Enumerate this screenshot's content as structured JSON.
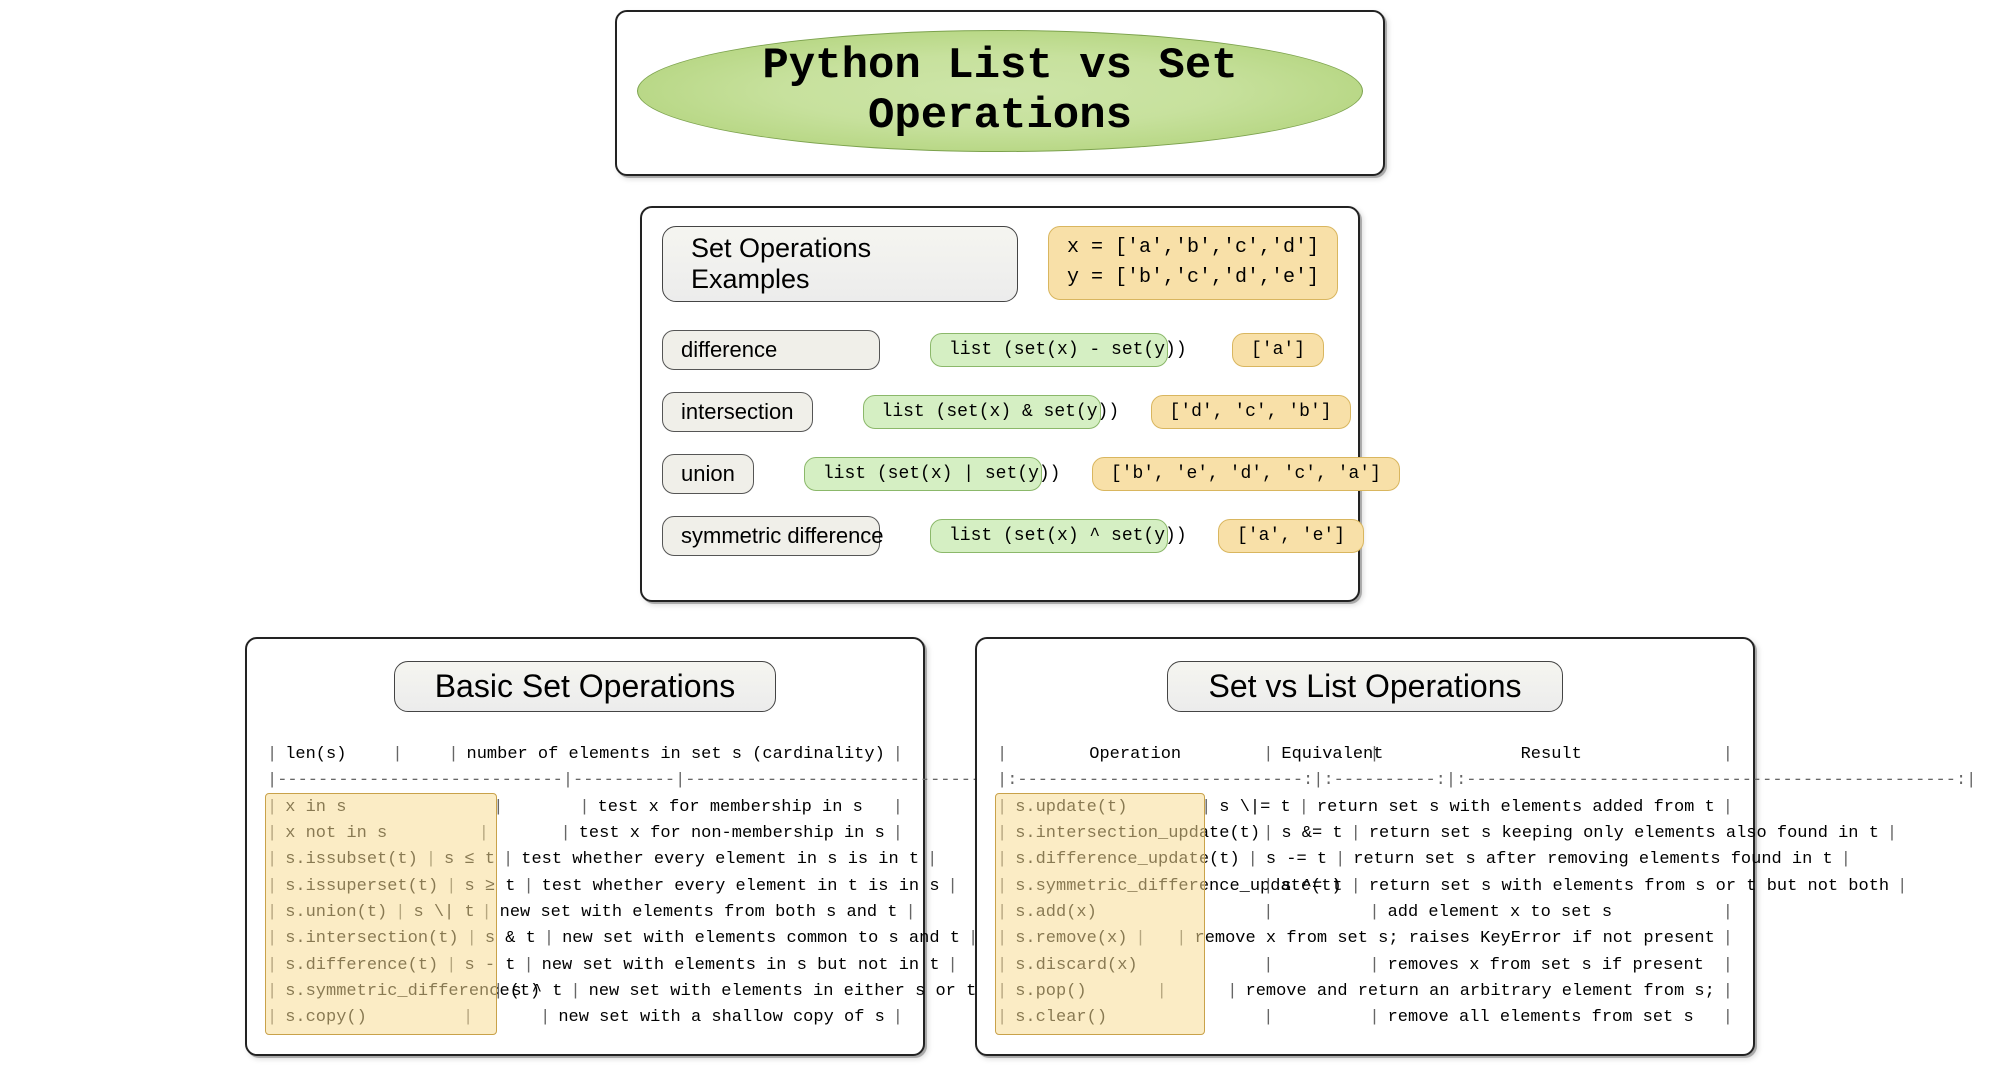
{
  "title": "Python List vs Set Operations",
  "examples": {
    "heading": "Set Operations Examples",
    "setup_x": "x = ['a','b','c','d']",
    "setup_y": "y = ['b','c','d','e']",
    "rows": [
      {
        "label": "difference",
        "code": "list (set(x) - set(y))",
        "result": "['a']"
      },
      {
        "label": "intersection",
        "code": "list (set(x) & set(y))",
        "result": "['d', 'c', 'b']"
      },
      {
        "label": "union",
        "code": "list (set(x) | set(y))",
        "result": "['b', 'e', 'd', 'c', 'a']"
      },
      {
        "label": "symmetric difference",
        "code": "list (set(x) ^ set(y))",
        "result": "['a', 'e']"
      }
    ]
  },
  "basic": {
    "heading": "Basic Set Operations",
    "header_op": "",
    "header_eq": "",
    "header_res": "",
    "rows": [
      {
        "op": "len(s)",
        "eq": "",
        "desc": "number of elements in set s (cardinality)"
      },
      {
        "sep": true
      },
      {
        "op": "x in s",
        "eq": "",
        "desc": "test x for membership in s"
      },
      {
        "op": "x not in s",
        "eq": "",
        "desc": "test x for non-membership in s"
      },
      {
        "op": "s.issubset(t)",
        "eq": "s ≤ t",
        "desc": "test whether every element in s is in t"
      },
      {
        "op": "s.issuperset(t)",
        "eq": "s ≥ t",
        "desc": "test whether every element in t is in s"
      },
      {
        "op": "s.union(t)",
        "eq": "s \\| t",
        "desc": "new set with elements from both s and t"
      },
      {
        "op": "s.intersection(t)",
        "eq": "s & t",
        "desc": "new set with elements common to s and t"
      },
      {
        "op": "s.difference(t)",
        "eq": "s - t",
        "desc": "new set with elements in s but not in t"
      },
      {
        "op": "s.symmetric_difference(t)",
        "eq": "s ^ t",
        "desc": "new set with elements in either s or t but not both"
      },
      {
        "op": "s.copy()",
        "eq": "",
        "desc": "new set with a shallow copy of s"
      }
    ]
  },
  "setvslist": {
    "heading": "Set vs List Operations",
    "header_op": "Operation",
    "header_eq": "Equivalent",
    "header_res": "Result",
    "rows": [
      {
        "op": "s.update(t)",
        "eq": "s \\|= t",
        "desc": "return set s with elements added from t"
      },
      {
        "op": "s.intersection_update(t)",
        "eq": "s &= t",
        "desc": "return set s keeping only elements also found in t"
      },
      {
        "op": "s.difference_update(t)",
        "eq": "s -= t",
        "desc": "return set s after removing elements found in t"
      },
      {
        "op": "s.symmetric_difference_update(t)",
        "eq": "s ^= t",
        "desc": "return set s with elements from s or t but not both"
      },
      {
        "op": "s.add(x)",
        "eq": "",
        "desc": "add element x to set s"
      },
      {
        "op": "s.remove(x)",
        "eq": "",
        "desc": "remove x from set s; raises KeyError if not present"
      },
      {
        "op": "s.discard(x)",
        "eq": "",
        "desc": "removes x from set s if present"
      },
      {
        "op": "s.pop()",
        "eq": "",
        "desc": "remove and return an arbitrary element from s;"
      },
      {
        "op": "s.clear()",
        "eq": "",
        "desc": "remove all elements from set s"
      }
    ]
  }
}
